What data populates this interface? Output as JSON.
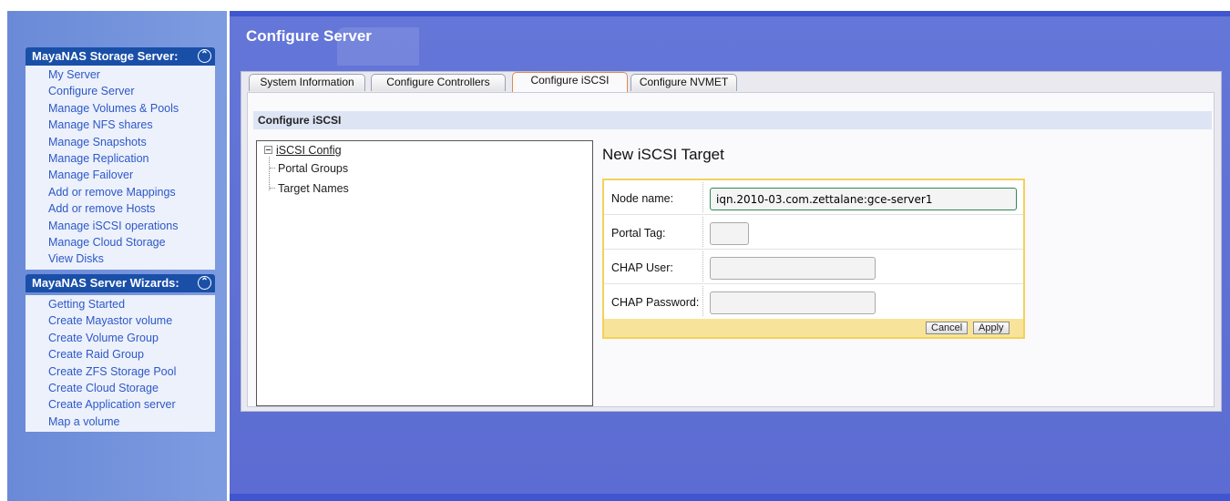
{
  "sidebar": {
    "sections": [
      {
        "title": "MayaNAS Storage Server:",
        "toggle_icon": "collapse-up-icon",
        "items": [
          "My Server",
          "Configure Server",
          "Manage Volumes & Pools",
          "Manage NFS shares",
          "Manage Snapshots",
          "Manage Replication",
          "Manage Failover",
          "Add or remove Mappings",
          "Add or remove Hosts",
          "Manage iSCSI operations",
          "Manage Cloud Storage",
          "View Disks"
        ]
      },
      {
        "title": "MayaNAS Server Wizards:",
        "toggle_icon": "collapse-up-icon",
        "items": [
          "Getting Started",
          "Create Mayastor volume",
          "Create Volume Group",
          "Create Raid Group",
          "Create ZFS Storage Pool",
          "Create Cloud Storage",
          "Create Application server",
          "Map a volume"
        ]
      }
    ]
  },
  "main": {
    "title": "Configure Server",
    "tabs": [
      {
        "label": "System Information",
        "active": false
      },
      {
        "label": "Configure Controllers",
        "active": false
      },
      {
        "label": "Configure iSCSI",
        "active": true
      },
      {
        "label": "Configure NVMET",
        "active": false
      }
    ],
    "section_title": "Configure iSCSI",
    "tree": {
      "root": "iSCSI Config",
      "children": [
        "Portal Groups",
        "Target Names"
      ]
    },
    "form": {
      "title": "New iSCSI Target",
      "fields": [
        {
          "label": "Node name:",
          "value": "iqn.2010-03.com.zettalane:gce-server1"
        },
        {
          "label": "Portal Tag:",
          "value": ""
        },
        {
          "label": "CHAP User:",
          "value": ""
        },
        {
          "label": "CHAP Password:",
          "value": ""
        }
      ],
      "cancel_label": "Cancel",
      "apply_label": "Apply"
    }
  },
  "colors": {
    "sidebar_header": "#1a4fa8",
    "sidebar_bg": "#6d8fd9",
    "main_bg": "#5e6fd4",
    "link": "#2c58c8",
    "active_tab_border": "#e08a4f",
    "form_border": "#f2d25b"
  }
}
